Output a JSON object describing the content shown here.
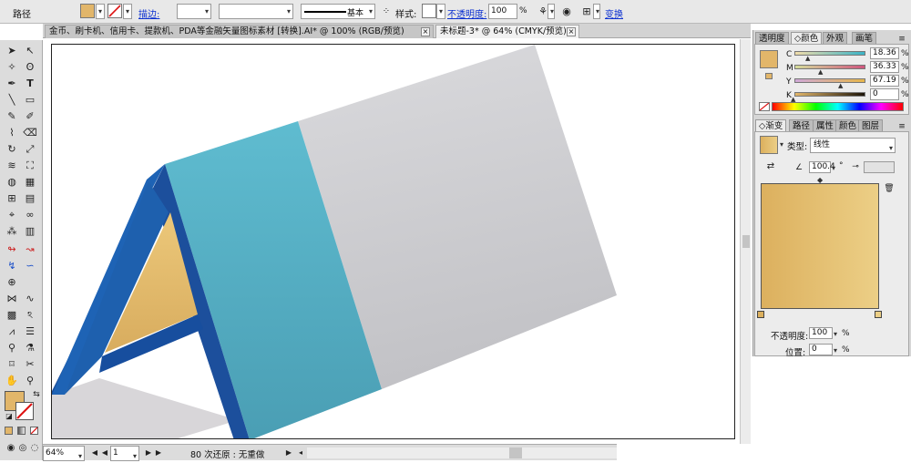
{
  "control_bar": {
    "object_type": "路径",
    "stroke_link": "描边:",
    "stroke_profile": "基本",
    "style_label": "样式:",
    "opacity_link": "不透明度:",
    "opacity_value": "100",
    "opacity_unit": "%",
    "transform_link": "变换"
  },
  "tabs": [
    {
      "label": "金币、刷卡机、信用卡、提款机、PDA等金融矢量图标素材 [转换].AI* @ 100% (RGB/预览)"
    },
    {
      "label": "未标题-3* @ 64% (CMYK/预览)"
    }
  ],
  "status_bar": {
    "zoom": "64%",
    "page": "1",
    "history": "80 次还原 : 无重做"
  },
  "color_panel": {
    "tabs": [
      "透明度",
      "◇颜色",
      "外观",
      "画笔"
    ],
    "channels": [
      {
        "name": "C",
        "value": "18.36"
      },
      {
        "name": "M",
        "value": "36.33"
      },
      {
        "name": "Y",
        "value": "67.19"
      },
      {
        "name": "K",
        "value": "0"
      }
    ],
    "unit": "%"
  },
  "gradient_panel": {
    "tabs": [
      "◇渐变",
      "路径",
      "属性",
      "颜色",
      "图层"
    ],
    "type_label": "类型:",
    "type_value": "线性",
    "angle_value": "100.4",
    "degree_mark": "°",
    "opacity_label": "不透明度:",
    "opacity_value": "100",
    "position_label": "位置:",
    "position_value": "0",
    "unit": "%"
  },
  "colors": {
    "fill": "#e2b66a",
    "gradient_start": "#dcb05e",
    "gradient_end": "#eccf86",
    "blue_dark": "#1a55a0",
    "blue_light": "#5ab5cb",
    "gray_face": "#cfcfd3"
  }
}
